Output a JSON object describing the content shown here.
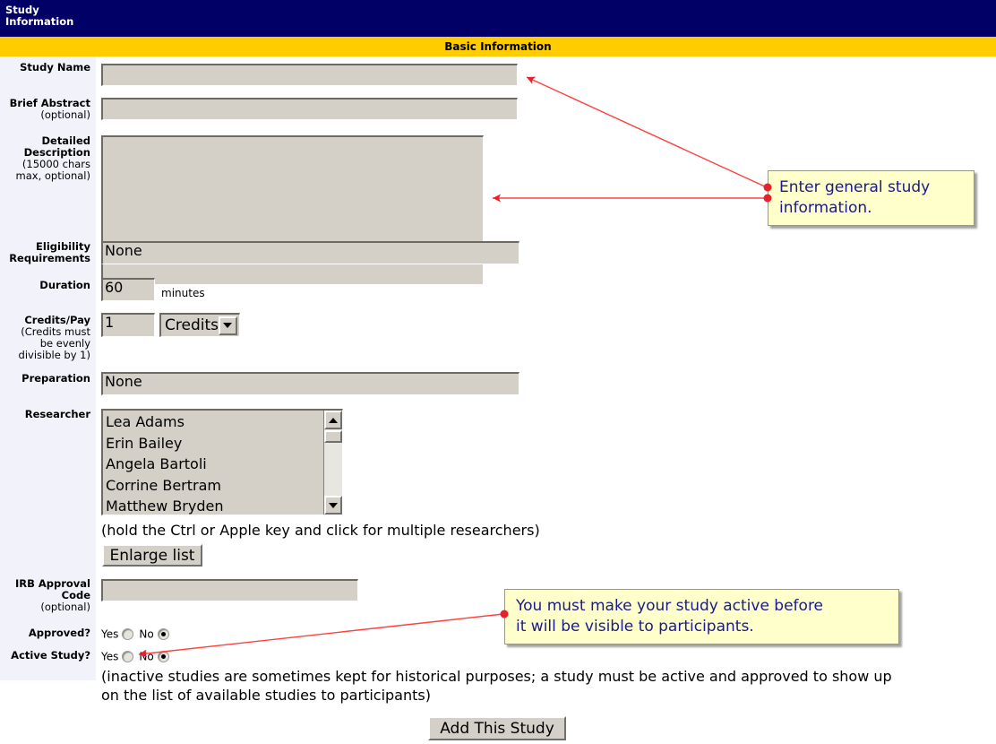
{
  "header": {
    "title": "Study\nInformation",
    "section": "Basic Information",
    "navy": "#000066",
    "gold": "#ffcc00"
  },
  "form": {
    "fields": [
      {
        "label": "Study Name",
        "sub": "",
        "value": ""
      },
      {
        "label": "Brief Abstract",
        "sub": "(optional)",
        "value": ""
      },
      {
        "label": "Detailed Description",
        "sub": "(15000 chars max, optional)",
        "value": ""
      },
      {
        "label": "Eligibility Requirements",
        "sub": "",
        "value": "None"
      },
      {
        "label": "Duration",
        "sub": "",
        "value": "60",
        "unit": "minutes"
      },
      {
        "label": "Credits/Pay",
        "sub": "(Credits must be evenly divisible by 1)",
        "value": "1",
        "select_value": "Credits"
      },
      {
        "label": "Preparation",
        "sub": "",
        "value": "None"
      },
      {
        "label": "Researcher",
        "sub": "",
        "value": ""
      },
      {
        "label": "IRB Approval Code",
        "sub": "(optional)",
        "value": ""
      },
      {
        "label": "Approved?",
        "sub": "",
        "value": "No"
      },
      {
        "label": "Active Study?",
        "sub": "",
        "value": "No"
      }
    ],
    "labels": {
      "study_name": "Study Name",
      "brief_abstract": "Brief Abstract",
      "brief_abstract_sub": "(optional)",
      "detailed_description": "Detailed\nDescription",
      "detailed_description_sub": "(15000 chars\nmax, optional)",
      "eligibility": "Eligibility\nRequirements",
      "duration": "Duration",
      "credits_pay": "Credits/Pay",
      "credits_pay_sub": "(Credits must\nbe evenly\ndivisible by 1)",
      "preparation": "Preparation",
      "researcher": "Researcher",
      "irb_code": "IRB Approval\nCode",
      "irb_code_sub": "(optional)",
      "approved": "Approved?",
      "active_study": "Active Study?"
    },
    "values": {
      "study_name": "",
      "brief_abstract": "",
      "detailed_description": "",
      "eligibility": "None",
      "duration": "60",
      "duration_unit": "minutes",
      "credits_amount": "1",
      "credits_type": "Credits",
      "preparation": "None",
      "irb_code": ""
    },
    "researchers": [
      "Lea Adams",
      "Erin Bailey",
      "Angela Bartoli",
      "Corrine Bertram",
      "Matthew Bryden"
    ],
    "researcher_hint": "(hold the Ctrl or Apple key and click for multiple researchers)",
    "enlarge_button": "Enlarge list",
    "radios": {
      "yes_label": "Yes",
      "no_label": "No",
      "approved_selected": "No",
      "active_selected": "No"
    },
    "active_note": "(inactive studies are sometimes kept for historical purposes; a study must be active and approved to show up\non the list of available studies to participants)",
    "submit_button": "Add This Study"
  },
  "callouts": [
    {
      "text": "Enter general study\ninformation."
    },
    {
      "text": "You must make your study active before\nit will be visible to participants."
    }
  ],
  "annotation_color": "#e8202a"
}
